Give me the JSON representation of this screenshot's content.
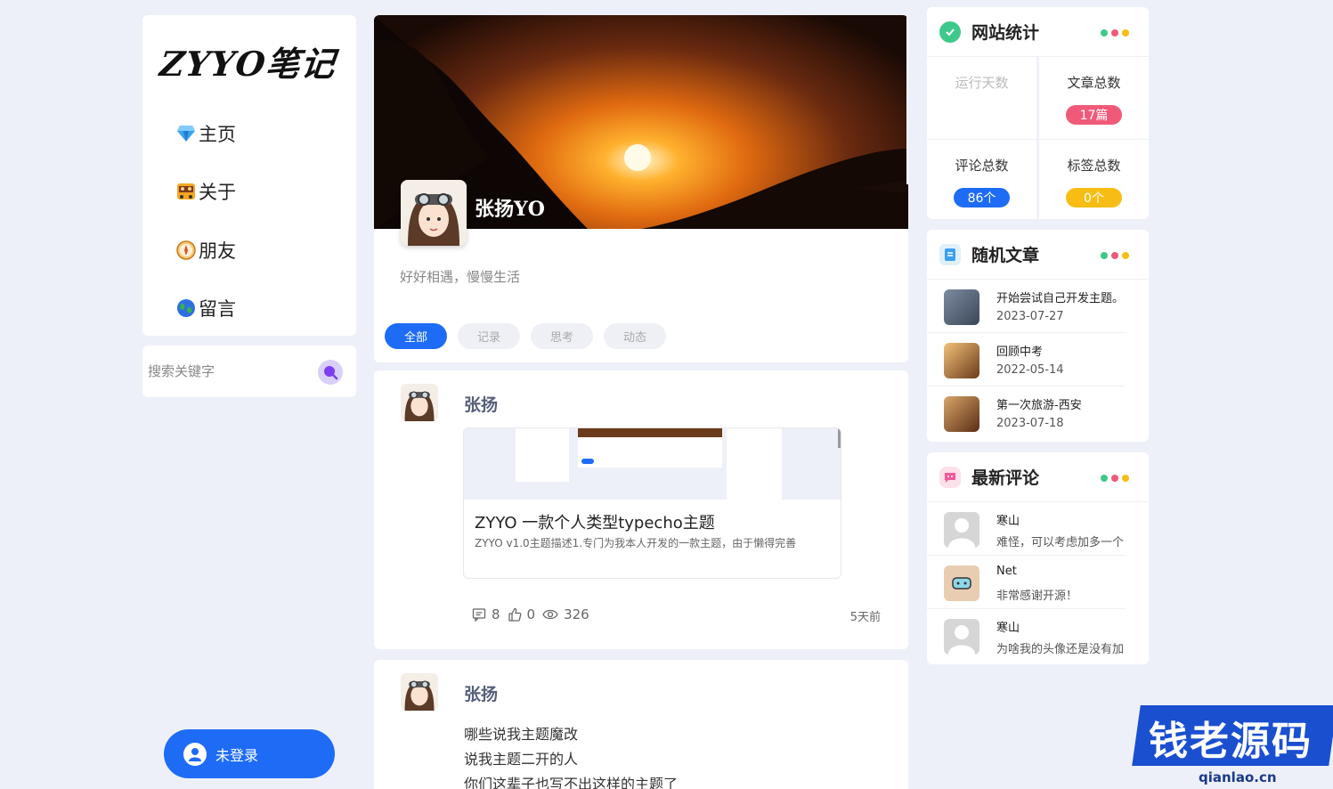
{
  "brand": {
    "logo_text": "ZYYO笔记"
  },
  "nav": [
    {
      "label": "主页",
      "icon": "diamond-icon"
    },
    {
      "label": "关于",
      "icon": "bus-icon"
    },
    {
      "label": "朋友",
      "icon": "compass-icon"
    },
    {
      "label": "留言",
      "icon": "globe-icon"
    }
  ],
  "search": {
    "placeholder": "搜索关键字"
  },
  "login": {
    "label": "未登录"
  },
  "profile": {
    "name": "张扬YO",
    "bio": "好好相遇，慢慢生活",
    "tabs": [
      "全部",
      "记录",
      "思考",
      "动态"
    ],
    "active_tab": "全部"
  },
  "posts": [
    {
      "author": "张扬",
      "link_card": {
        "title": "ZYYO 一款个人类型typecho主题",
        "description": "ZYYO v1.0主题描述1.专门为我本人开发的一款主题，由于懒得完善"
      },
      "comments": "8",
      "likes": "0",
      "views": "326",
      "time": "5天前"
    },
    {
      "author": "张扬",
      "lines": [
        "哪些说我主题魔改",
        "说我主题二开的人",
        "你们这辈子也写不出这样的主题了"
      ]
    }
  ],
  "stats_widget": {
    "title": "网站统计",
    "cells": [
      {
        "label": "运行天数",
        "value": "",
        "color": "#cccccc"
      },
      {
        "label": "文章总数",
        "value": "17篇",
        "color": "#f05a78"
      },
      {
        "label": "评论总数",
        "value": "86个",
        "color": "#1e6cf5"
      },
      {
        "label": "标签总数",
        "value": "0个",
        "color": "#f8bd14"
      }
    ]
  },
  "random_widget": {
    "title": "随机文章",
    "items": [
      {
        "title": "开始尝试自己开发主题。",
        "date": "2023-07-27"
      },
      {
        "title": "回顾中考",
        "date": "2022-05-14"
      },
      {
        "title": "第一次旅游-西安",
        "date": "2023-07-18"
      }
    ]
  },
  "comments_widget": {
    "title": "最新评论",
    "items": [
      {
        "name": "寒山",
        "text": "难怪，可以考虑加多一个"
      },
      {
        "name": "Net",
        "text": "非常感谢开源！"
      },
      {
        "name": "寒山",
        "text": "为啥我的头像还是没有加"
      }
    ]
  },
  "dot_colors": [
    "#3ec98a",
    "#f05a78",
    "#f8bd14"
  ],
  "watermark": {
    "text": "钱老源码",
    "domain": "qianlao.cn"
  }
}
